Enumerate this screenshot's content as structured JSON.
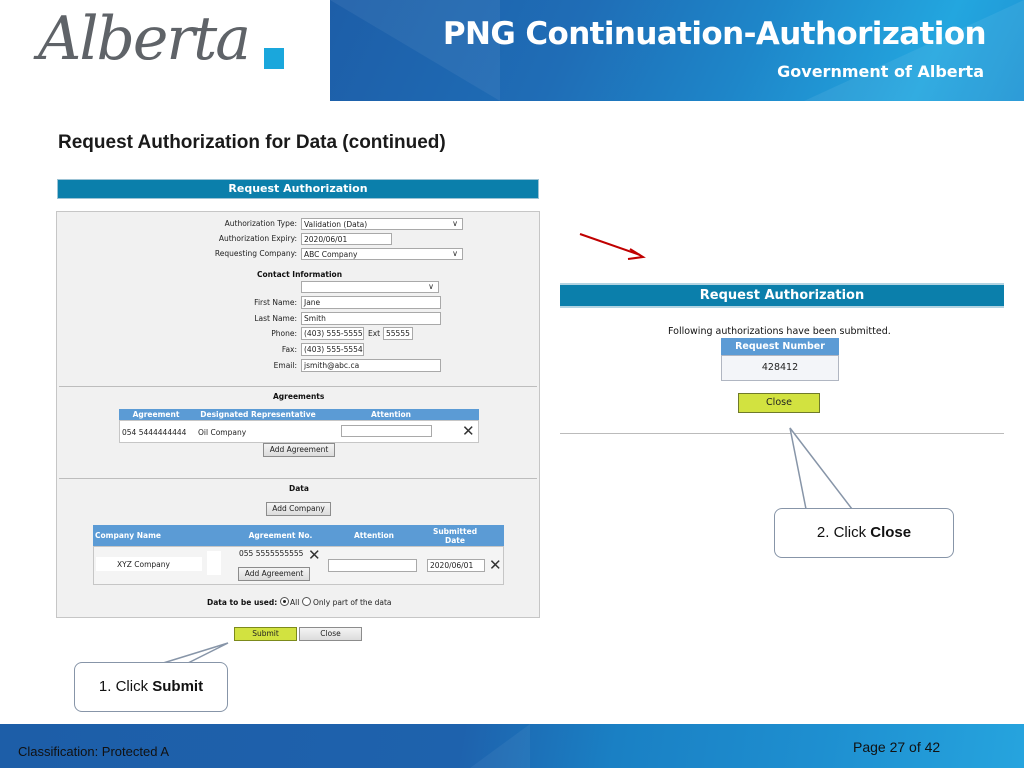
{
  "header": {
    "logo_text": "Alberta",
    "title": "PNG Continuation-Authorization",
    "subtitle": "Government of Alberta"
  },
  "slide": {
    "heading": "Request Authorization for Data (continued)"
  },
  "form": {
    "title": "Request Authorization",
    "authorization_type": {
      "label": "Authorization Type:",
      "value": "Validation (Data)"
    },
    "authorization_expiry": {
      "label": "Authorization Expiry:",
      "value": "2020/06/01"
    },
    "requesting_company": {
      "label": "Requesting Company:",
      "value": "ABC Company"
    },
    "contact": {
      "title": "Contact Information",
      "contact_select_value": "",
      "first_name": {
        "label": "First Name:",
        "value": "Jane"
      },
      "last_name": {
        "label": "Last Name:",
        "value": "Smith"
      },
      "phone": {
        "label": "Phone:",
        "value": "(403) 555-5555",
        "ext_label": "Ext",
        "ext_value": "55555"
      },
      "fax": {
        "label": "Fax:",
        "value": "(403) 555-5554"
      },
      "email": {
        "label": "Email:",
        "value": "jsmith@abc.ca"
      }
    },
    "agreements": {
      "title": "Agreements",
      "headers": [
        "Agreement",
        "Designated Representative",
        "Attention"
      ],
      "rows": [
        {
          "agreement": "054 5444444444",
          "representative": "Oil Company",
          "attention": ""
        }
      ],
      "add_button": "Add Agreement"
    },
    "data": {
      "title": "Data",
      "add_company_button": "Add Company",
      "headers": [
        "Company Name",
        "Agreement No.",
        "Attention",
        "Submitted Date"
      ],
      "rows": [
        {
          "company": "XYZ Company",
          "agreement_no": "055 5555555555",
          "add_agreement": "Add Agreement",
          "attention": "",
          "submitted_date": "2020/06/01"
        }
      ],
      "usage_label": "Data to be used:",
      "usage_options": [
        "All",
        "Only part of the data"
      ],
      "usage_selected": "All"
    },
    "submit_button": "Submit",
    "close_button": "Close"
  },
  "confirmation": {
    "title": "Request Authorization",
    "message": "Following authorizations have been submitted.",
    "table_header": "Request Number",
    "request_number": "428412",
    "close_button": "Close"
  },
  "callouts": {
    "step1_prefix": "1. Click ",
    "step1_action": "Submit",
    "step2_prefix": "2. Click ",
    "step2_action": "Close"
  },
  "colors": {
    "header_blue": "#1f6db6",
    "form_title_teal": "#0b7fab",
    "table_header_blue": "#5b9bd5",
    "action_button_green": "#d2e240",
    "arrow_red": "#c00000"
  },
  "footer": {
    "classification": "Classification: Protected A",
    "page": "Page 27 of 42"
  }
}
